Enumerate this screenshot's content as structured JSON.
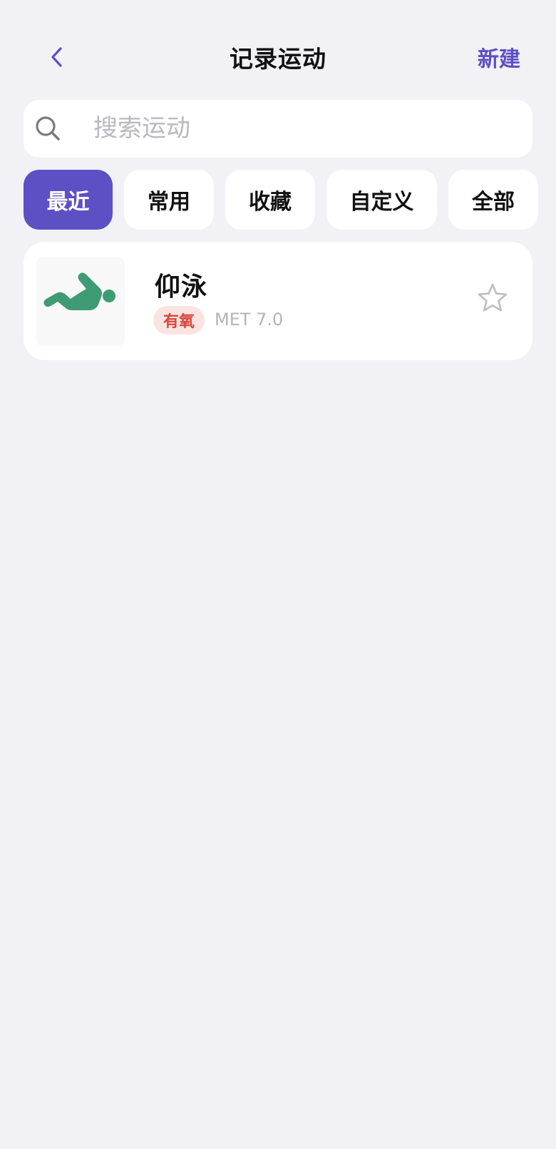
{
  "header": {
    "title": "记录运动",
    "new_label": "新建"
  },
  "search": {
    "placeholder": "搜索运动",
    "value": ""
  },
  "tabs": [
    {
      "label": "最近",
      "active": true
    },
    {
      "label": "常用",
      "active": false
    },
    {
      "label": "收藏",
      "active": false
    },
    {
      "label": "自定义",
      "active": false
    },
    {
      "label": "全部",
      "active": false
    }
  ],
  "exercises": [
    {
      "name": "仰泳",
      "tag": "有氧",
      "met": "MET 7.0",
      "icon": "backstroke-swimmer-icon",
      "favorited": false
    }
  ],
  "colors": {
    "accent": "#5d4fc4",
    "background": "#f1f1f6",
    "tag_bg": "#fbe3e1",
    "tag_text": "#d9473d",
    "icon_green": "#3f9b73"
  }
}
